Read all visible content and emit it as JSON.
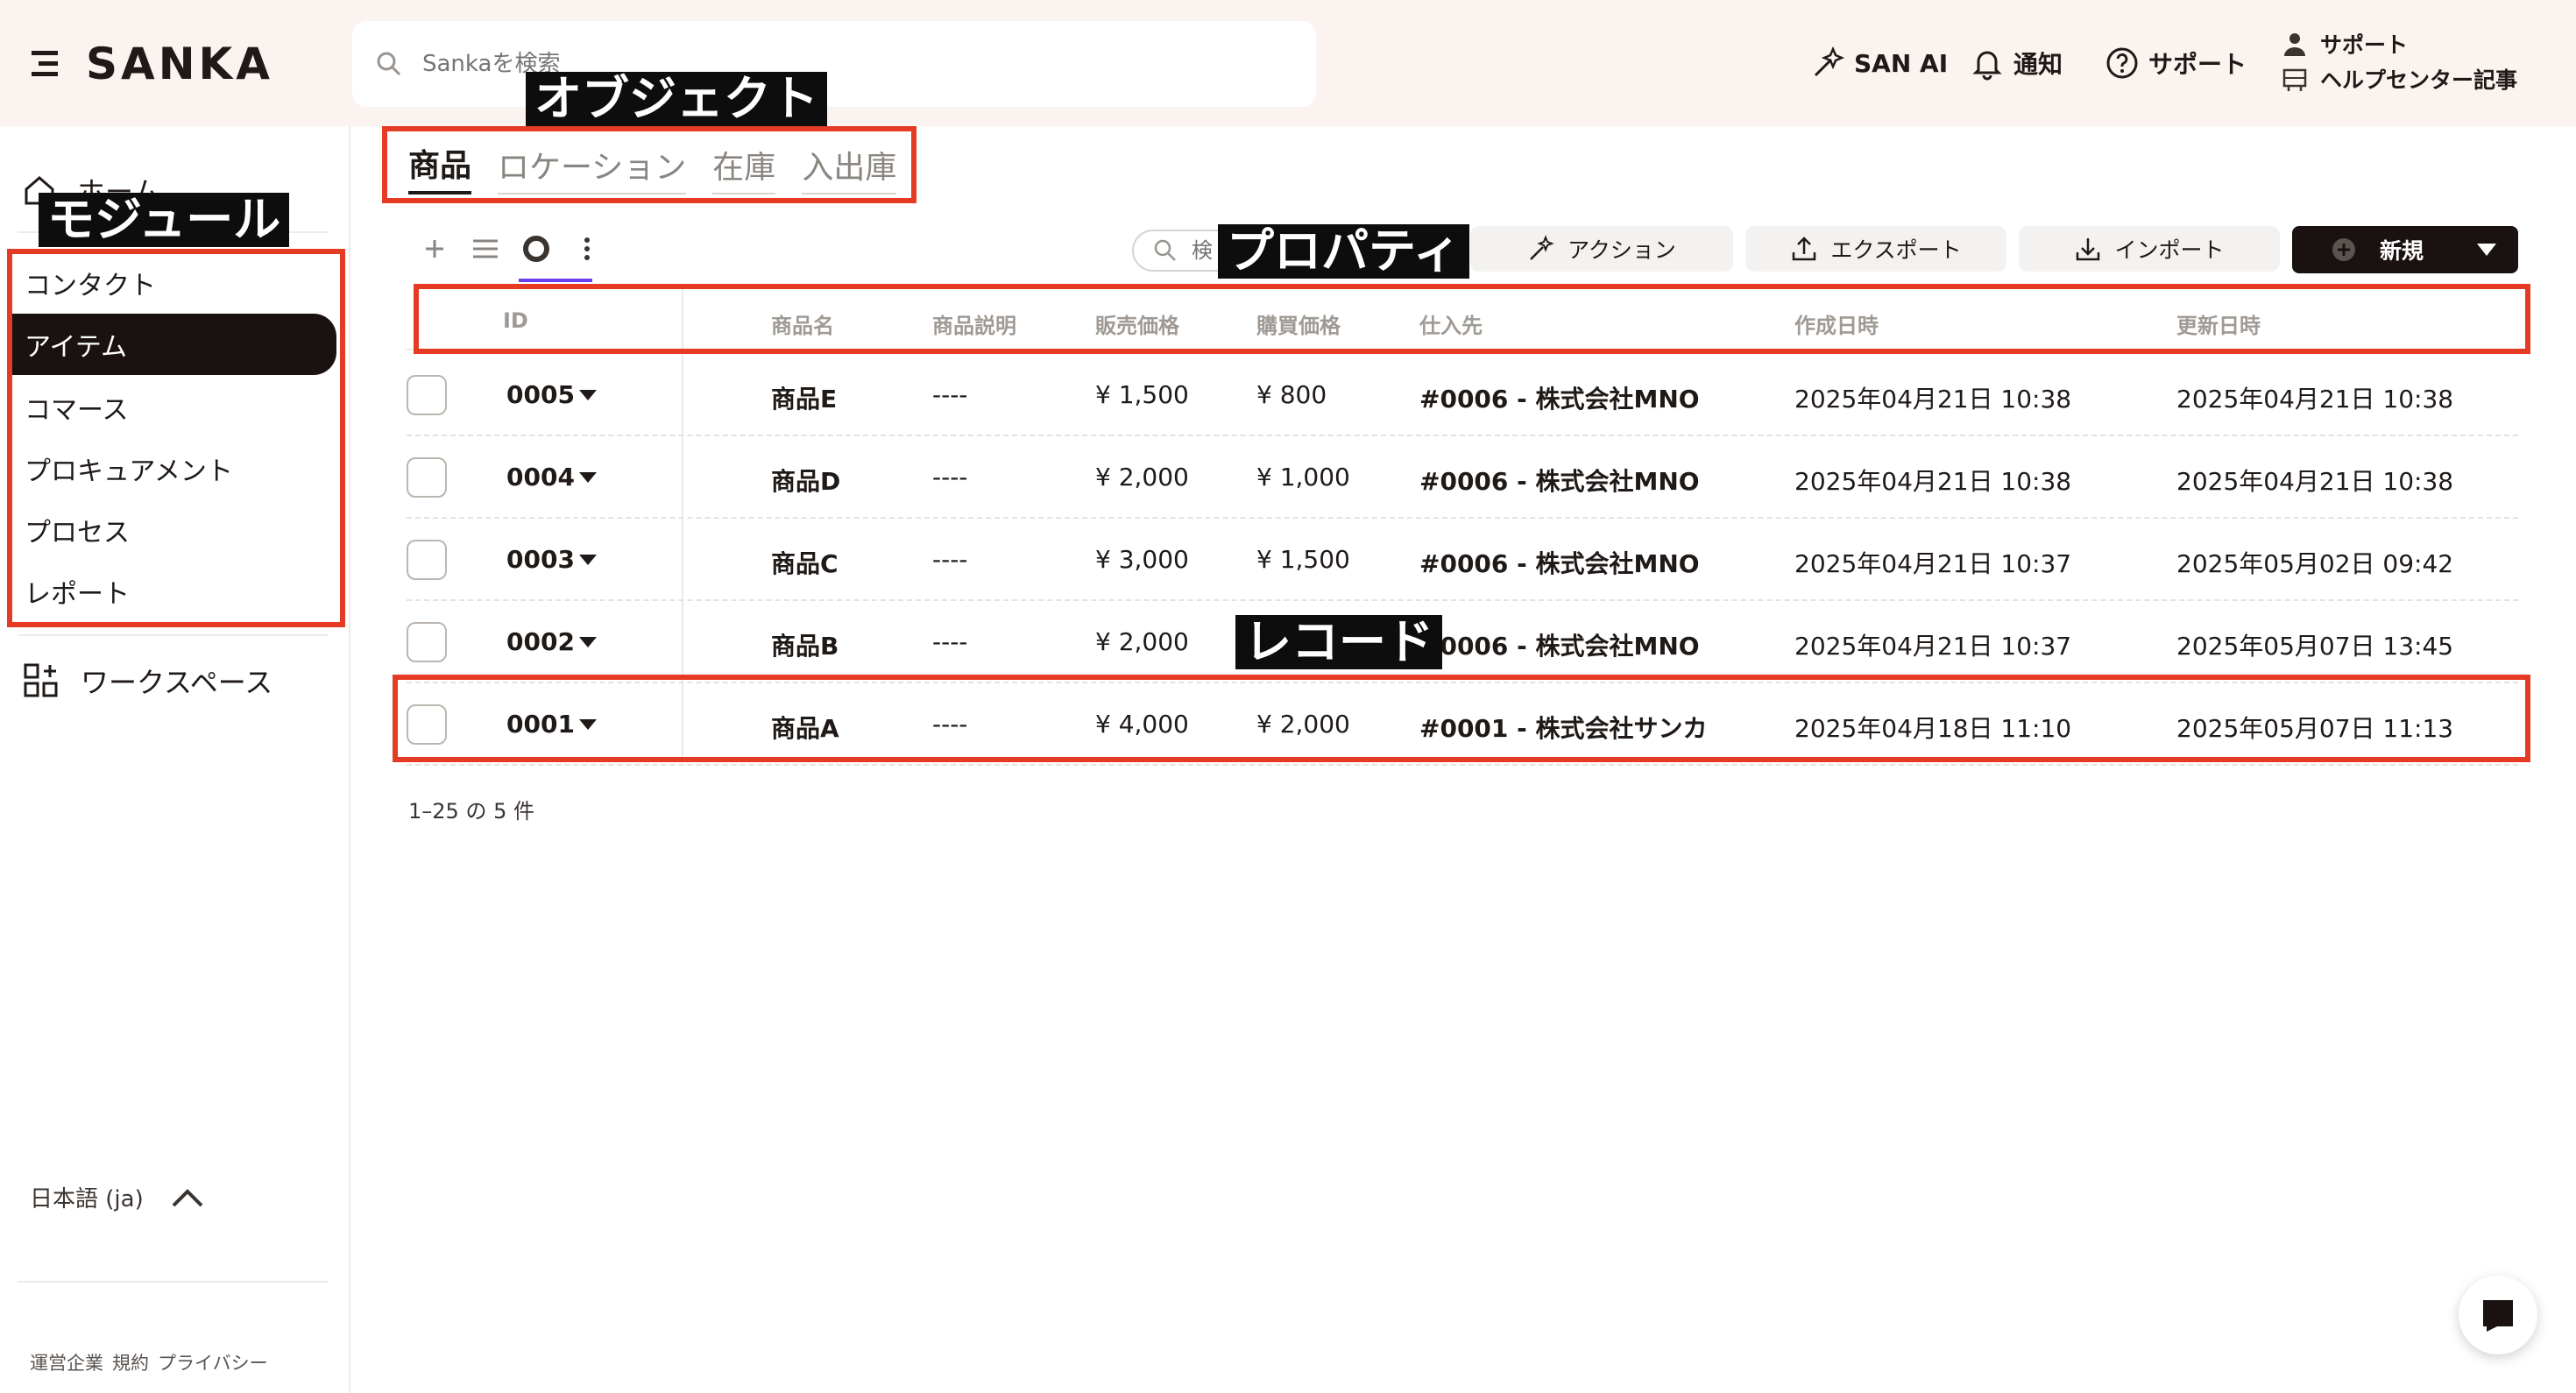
{
  "header": {
    "logo_text": "SANKA",
    "search_placeholder": "Sankaを検索",
    "san_ai": "SAN AI",
    "notifications": "通知",
    "support": "サポート",
    "support_top": "サポート",
    "help_center": "ヘルプセンター記事"
  },
  "sidebar": {
    "home": "ホーム",
    "modules": [
      "コンタクト",
      "アイテム",
      "コマース",
      "プロキュアメント",
      "プロセス",
      "レポート"
    ],
    "active_module": "アイテム",
    "workspace": "ワークスペース",
    "language": "日本語 (ja)",
    "footer_links": [
      "運営企業",
      "規約",
      "プライバシー"
    ]
  },
  "object_tabs": [
    "商品",
    "ロケーション",
    "在庫",
    "入出庫"
  ],
  "toolbar": {
    "search_placeholder": "検",
    "action": "アクション",
    "export": "エクスポート",
    "import": "インポート",
    "new": "新規"
  },
  "table": {
    "columns": [
      "ID",
      "商品名",
      "商品説明",
      "販売価格",
      "購買価格",
      "仕入先",
      "作成日時",
      "更新日時"
    ],
    "rows": [
      {
        "id": "0005",
        "name": "商品E",
        "desc": "----",
        "sell": "¥ 1,500",
        "buy": "¥ 800",
        "supplier": "#0006 - 株式会社MNO",
        "created": "2025年04月21日 10:38",
        "updated": "2025年04月21日 10:38"
      },
      {
        "id": "0004",
        "name": "商品D",
        "desc": "----",
        "sell": "¥ 2,000",
        "buy": "¥ 1,000",
        "supplier": "#0006 - 株式会社MNO",
        "created": "2025年04月21日 10:38",
        "updated": "2025年04月21日 10:38"
      },
      {
        "id": "0003",
        "name": "商品C",
        "desc": "----",
        "sell": "¥ 3,000",
        "buy": "¥ 1,500",
        "supplier": "#0006 - 株式会社MNO",
        "created": "2025年04月21日 10:37",
        "updated": "2025年05月02日 09:42"
      },
      {
        "id": "0002",
        "name": "商品B",
        "desc": "----",
        "sell": "¥ 2,000",
        "buy": "",
        "supplier": "#0006 - 株式会社MNO",
        "created": "2025年04月21日 10:37",
        "updated": "2025年05月07日 13:45"
      },
      {
        "id": "0001",
        "name": "商品A",
        "desc": "----",
        "sell": "¥ 4,000",
        "buy": "¥ 2,000",
        "supplier": "#0001 - 株式会社サンカ",
        "created": "2025年04月18日 11:10",
        "updated": "2025年05月07日 11:13"
      }
    ],
    "pagination": "1–25 の 5 件"
  },
  "annotations": {
    "module": "モジュール",
    "object": "オブジェクト",
    "property": "プロパティ",
    "record": "レコード"
  },
  "colors": {
    "header_bg": "#fbf3ef",
    "annotation_red": "#e53a24",
    "active_dark": "#1a1210",
    "view_accent": "#6b3ff0"
  },
  "icons": [
    "menu-icon",
    "search-icon",
    "magic-wand-icon",
    "bell-icon",
    "help-circle-icon",
    "person-icon",
    "help-center-icon",
    "home-icon",
    "grid-plus-icon",
    "chevron-up-icon",
    "plus-icon",
    "list-icon",
    "circle-view-icon",
    "more-vertical-icon",
    "upload-icon",
    "download-icon",
    "caret-down-icon",
    "chat-icon"
  ]
}
